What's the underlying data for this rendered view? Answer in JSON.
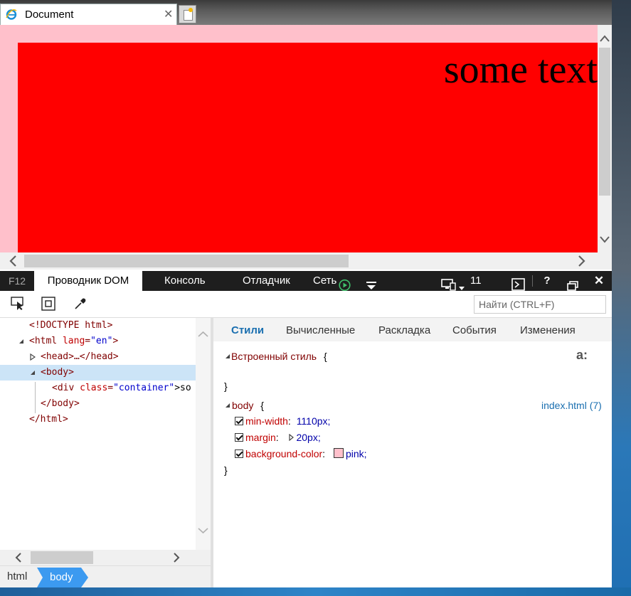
{
  "browser": {
    "tab_title": "Document",
    "tab_close": "✕"
  },
  "page": {
    "text": "some text",
    "colors": {
      "background": "#ffc0cb",
      "container": "#ff0000"
    }
  },
  "devtools": {
    "f12_label": "F12",
    "tabs": [
      "Проводник DOM",
      "Консоль",
      "Отладчик",
      "Сеть"
    ],
    "emulation_count": "11",
    "help_label": "?",
    "close_label": "✕",
    "find_placeholder": "Найти (CTRL+F)",
    "dom": {
      "doctype": "<!DOCTYPE html>",
      "html_open": "<html",
      "html_lang_attr": "lang",
      "html_lang_val": "\"en\"",
      "html_close_bracket": ">",
      "head": "<head>…</head>",
      "body_open": "<body>",
      "div_open": "<div",
      "div_class_attr": "class",
      "div_class_val": "\"container\"",
      "div_rest": ">so",
      "body_close": "</body>",
      "html_close": "</html>"
    },
    "breadcrumb": [
      "html",
      "body"
    ],
    "styles": {
      "tabs": [
        "Стили",
        "Вычисленные",
        "Раскладка",
        "События",
        "Изменения"
      ],
      "inline_label": "Встроенный стиль",
      "open_brace": "{",
      "close_brace": "}",
      "pseudo_label": "a:",
      "body_selector": "body",
      "source": "index.html (7)",
      "declarations": [
        {
          "prop": "min-width",
          "value": "1110px;"
        },
        {
          "prop": "margin",
          "value": "20px;"
        },
        {
          "prop": "background-color",
          "value": "pink;"
        }
      ]
    }
  }
}
